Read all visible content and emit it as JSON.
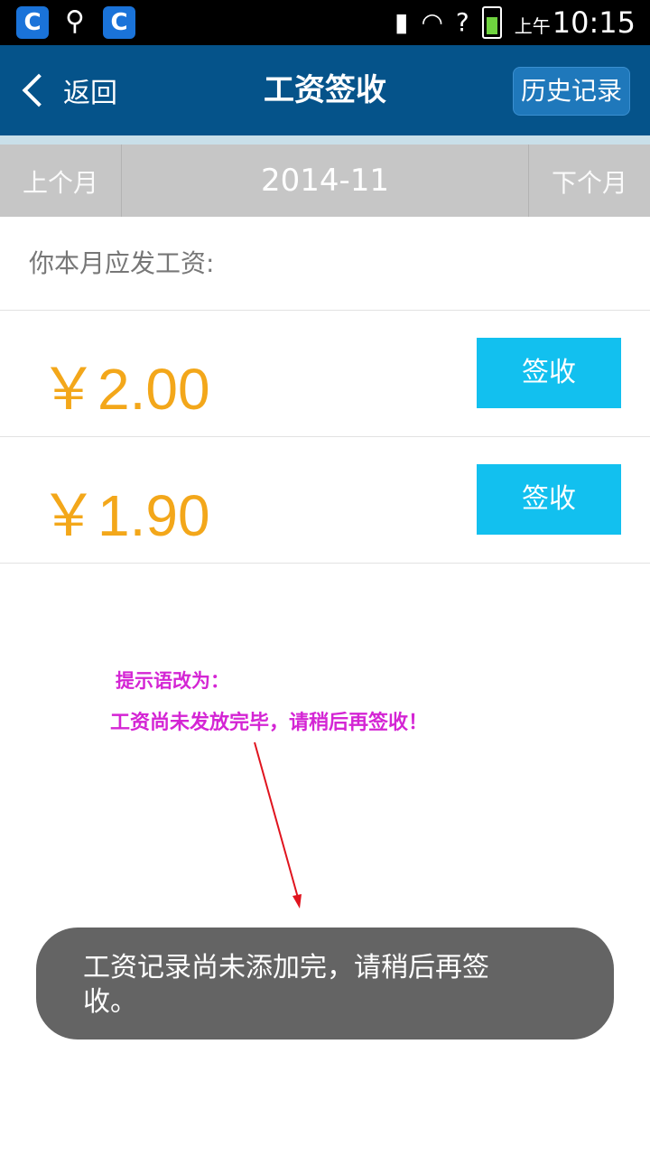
{
  "status_bar": {
    "app_icons": [
      "app-logo-icon",
      "usb-icon",
      "app-logo-icon"
    ],
    "icons": [
      "sd-card-icon",
      "wifi-icon",
      "no-sim-icon",
      "battery-icon"
    ],
    "ampm": "上午",
    "time": "10:15"
  },
  "header": {
    "back_label": "返回",
    "title": "工资签收",
    "history_button": "历史记录"
  },
  "month_nav": {
    "prev": "上个月",
    "current": "2014-11",
    "next": "下个月"
  },
  "salary": {
    "label": "你本月应发工资:",
    "items": [
      {
        "amount": "￥2.00",
        "button": "签收"
      },
      {
        "amount": "￥1.90",
        "button": "签收"
      }
    ]
  },
  "annotation": {
    "line1": "提示语改为：",
    "line2": "工资尚未发放完毕，请稍后再签收！",
    "color": "#d425d4",
    "arrow_color": "#e0141e"
  },
  "toast": {
    "message": "工资记录尚未添加完，请稍后再签收。"
  },
  "colors": {
    "header_bg": "#05538a",
    "month_bar_bg": "#c6c6c6",
    "amount": "#f3a71a",
    "sign_button": "#12c0ef",
    "toast_bg": "#646464"
  }
}
